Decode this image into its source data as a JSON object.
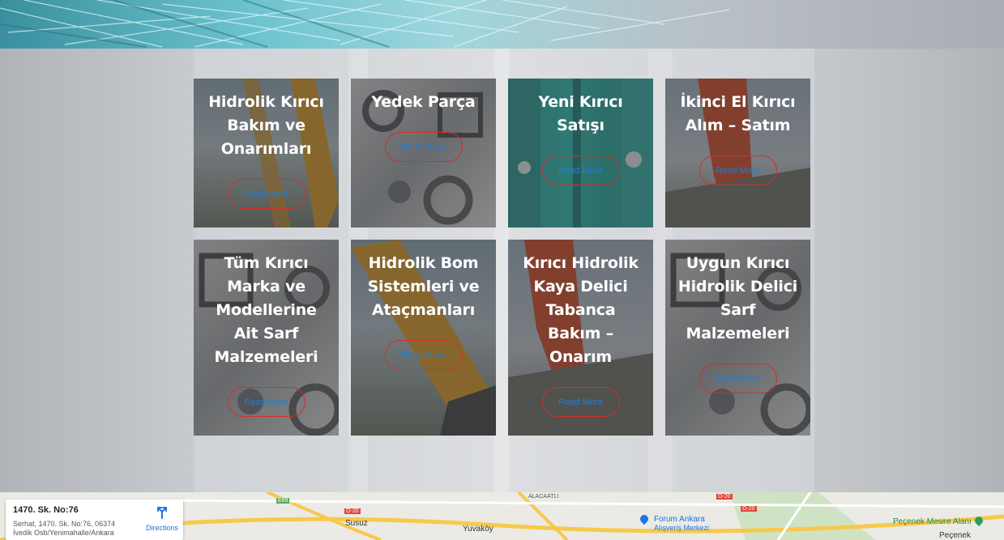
{
  "cards": [
    {
      "title": "Hidrolik Kırıcı Bakım ve Onarımları",
      "button": "Read More",
      "image": "excavator-arm"
    },
    {
      "title": "Yedek Parça",
      "button": "Read More",
      "image": "machined-parts"
    },
    {
      "title": "Yeni Kırıcı Satışı",
      "button": "Read More",
      "image": "teal-breakers"
    },
    {
      "title": "İkinci El Kırıcı Alım – Satım",
      "button": "Read More",
      "image": "orange-breaker"
    },
    {
      "title": "Tüm Kırıcı Marka ve Modellerine Ait Sarf Malzemeleri",
      "button": "Read More",
      "image": "machined-parts"
    },
    {
      "title": "Hidrolik Bom Sistemleri ve Ataçmanları",
      "button": "Read More",
      "image": "excavator-arm"
    },
    {
      "title": "Kırıcı Hidrolik Kaya Delici Tabanca Bakım – Onarım",
      "button": "Read More",
      "image": "orange-breaker"
    },
    {
      "title": "Uygun Kırıcı Hidrolik Delici Sarf Malzemeleri",
      "button": "Read More",
      "image": "machined-parts"
    }
  ],
  "map": {
    "address_title": "1470. Sk. No:76",
    "address_line1": "Serhat, 1470. Sk. No:76, 06374",
    "address_line2": "İvedik Osb/Yenimahalle/Ankara",
    "directions_label": "Directions",
    "places": {
      "alacaatli": "ALACAATLI",
      "susuz": "Susuz",
      "yuvakoy": "Yuvaköy",
      "forum_line1": "Forum Ankara",
      "forum_line2": "Alışveriş Merkezi",
      "pecenek_park": "Peçenek Mesire Alanı",
      "pecenek": "Peçenek",
      "road_e89": "E89",
      "road_o20a": "O-20",
      "road_o20b": "O-20",
      "road_o20c": "O-20"
    }
  },
  "colors": {
    "button_border": "#d2302a",
    "button_text": "#1e7fd6",
    "card_overlay": "rgba(60,60,60,0.55)"
  }
}
